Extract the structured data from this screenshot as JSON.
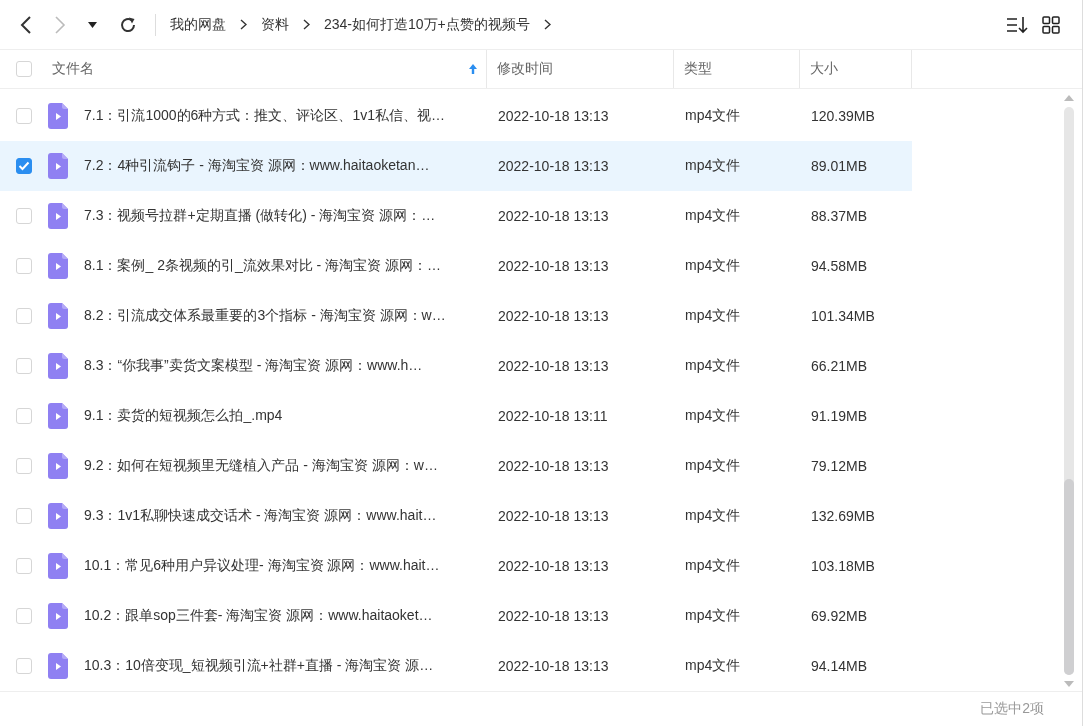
{
  "toolbar": {
    "breadcrumb": [
      {
        "label": "我的网盘"
      },
      {
        "label": "资料"
      },
      {
        "label": "234-如何打造10万+点赞的视频号"
      }
    ]
  },
  "table": {
    "select_all": {
      "checked": false
    },
    "columns": [
      {
        "label": "文件名"
      },
      {
        "label": "修改时间"
      },
      {
        "label": "类型"
      },
      {
        "label": "大小"
      }
    ],
    "rows": [
      {
        "name": "7.1：引流1000的6种方式：推文、评论区、1v1私信、视…",
        "modified": "2022-10-18 13:13",
        "type": "mp4文件",
        "size": "120.39MB",
        "selected": false
      },
      {
        "name": "7.2：4种引流钩子 - 海淘宝资 源网：www.haitaoketan…",
        "modified": "2022-10-18 13:13",
        "type": "mp4文件",
        "size": "89.01MB",
        "selected": true
      },
      {
        "name": "7.3：视频号拉群+定期直播 (做转化) - 海淘宝资 源网：…",
        "modified": "2022-10-18 13:13",
        "type": "mp4文件",
        "size": "88.37MB",
        "selected": false
      },
      {
        "name": "8.1：案例_ 2条视频的引_流效果对比 - 海淘宝资 源网：…",
        "modified": "2022-10-18 13:13",
        "type": "mp4文件",
        "size": "94.58MB",
        "selected": false
      },
      {
        "name": "8.2：引流成交体系最重要的3个指标 - 海淘宝资 源网：w…",
        "modified": "2022-10-18 13:13",
        "type": "mp4文件",
        "size": "101.34MB",
        "selected": false
      },
      {
        "name": "8.3：“你我事”卖货文案模型 - 海淘宝资 源网：www.h…",
        "modified": "2022-10-18 13:13",
        "type": "mp4文件",
        "size": "66.21MB",
        "selected": false
      },
      {
        "name": "9.1：卖货的短视频怎么拍_.mp4",
        "modified": "2022-10-18 13:11",
        "type": "mp4文件",
        "size": "91.19MB",
        "selected": false
      },
      {
        "name": "9.2：如何在短视频里无缝植入产品 - 海淘宝资 源网：w…",
        "modified": "2022-10-18 13:13",
        "type": "mp4文件",
        "size": "79.12MB",
        "selected": false
      },
      {
        "name": "9.3：1v1私聊快速成交话术 - 海淘宝资 源网：www.hait…",
        "modified": "2022-10-18 13:13",
        "type": "mp4文件",
        "size": "132.69MB",
        "selected": false
      },
      {
        "name": "10.1：常见6种用户异议处理- 海淘宝资 源网：www.hait…",
        "modified": "2022-10-18 13:13",
        "type": "mp4文件",
        "size": "103.18MB",
        "selected": false
      },
      {
        "name": "10.2：跟单sop三件套- 海淘宝资 源网：www.haitaoket…",
        "modified": "2022-10-18 13:13",
        "type": "mp4文件",
        "size": "69.92MB",
        "selected": false
      },
      {
        "name": "10.3：10倍变现_短视频引流+社群+直播 - 海淘宝资 源…",
        "modified": "2022-10-18 13:13",
        "type": "mp4文件",
        "size": "94.14MB",
        "selected": false
      }
    ]
  },
  "status_bar": {
    "text": "已选中2项"
  }
}
